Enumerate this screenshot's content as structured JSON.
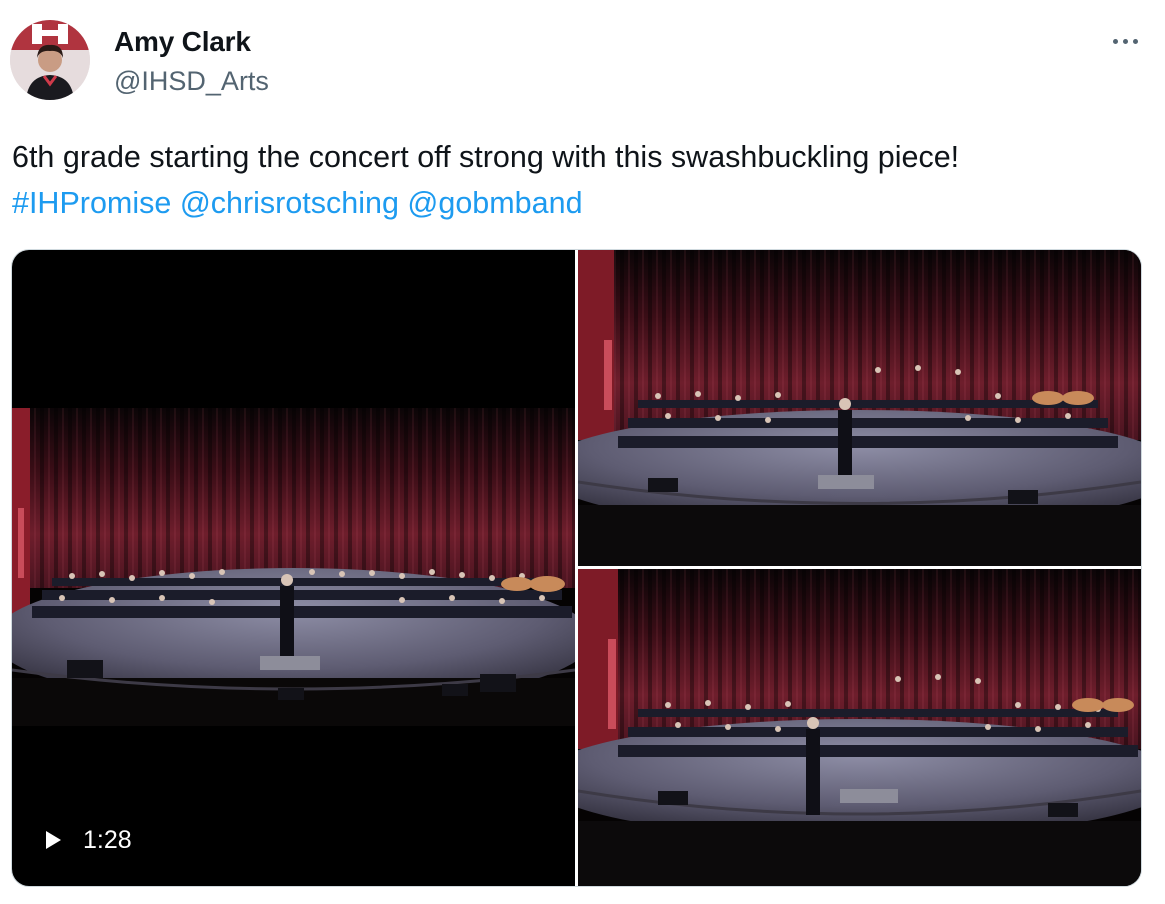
{
  "author": {
    "name": "Amy Clark",
    "handle": "@IHSD_Arts"
  },
  "tweet": {
    "text": "6th grade starting the concert off strong with this swashbuckling piece!",
    "hashtag": "#IHPromise",
    "mentions": [
      "@chrisrotsching",
      "@gobmband"
    ]
  },
  "media": {
    "video_duration": "1:28",
    "icons": {
      "more": "more-horizontal-icon",
      "play": "play-icon"
    }
  },
  "colors": {
    "link": "#1d9bf0",
    "secondary_text": "#536471",
    "curtain": "#5a1622"
  }
}
